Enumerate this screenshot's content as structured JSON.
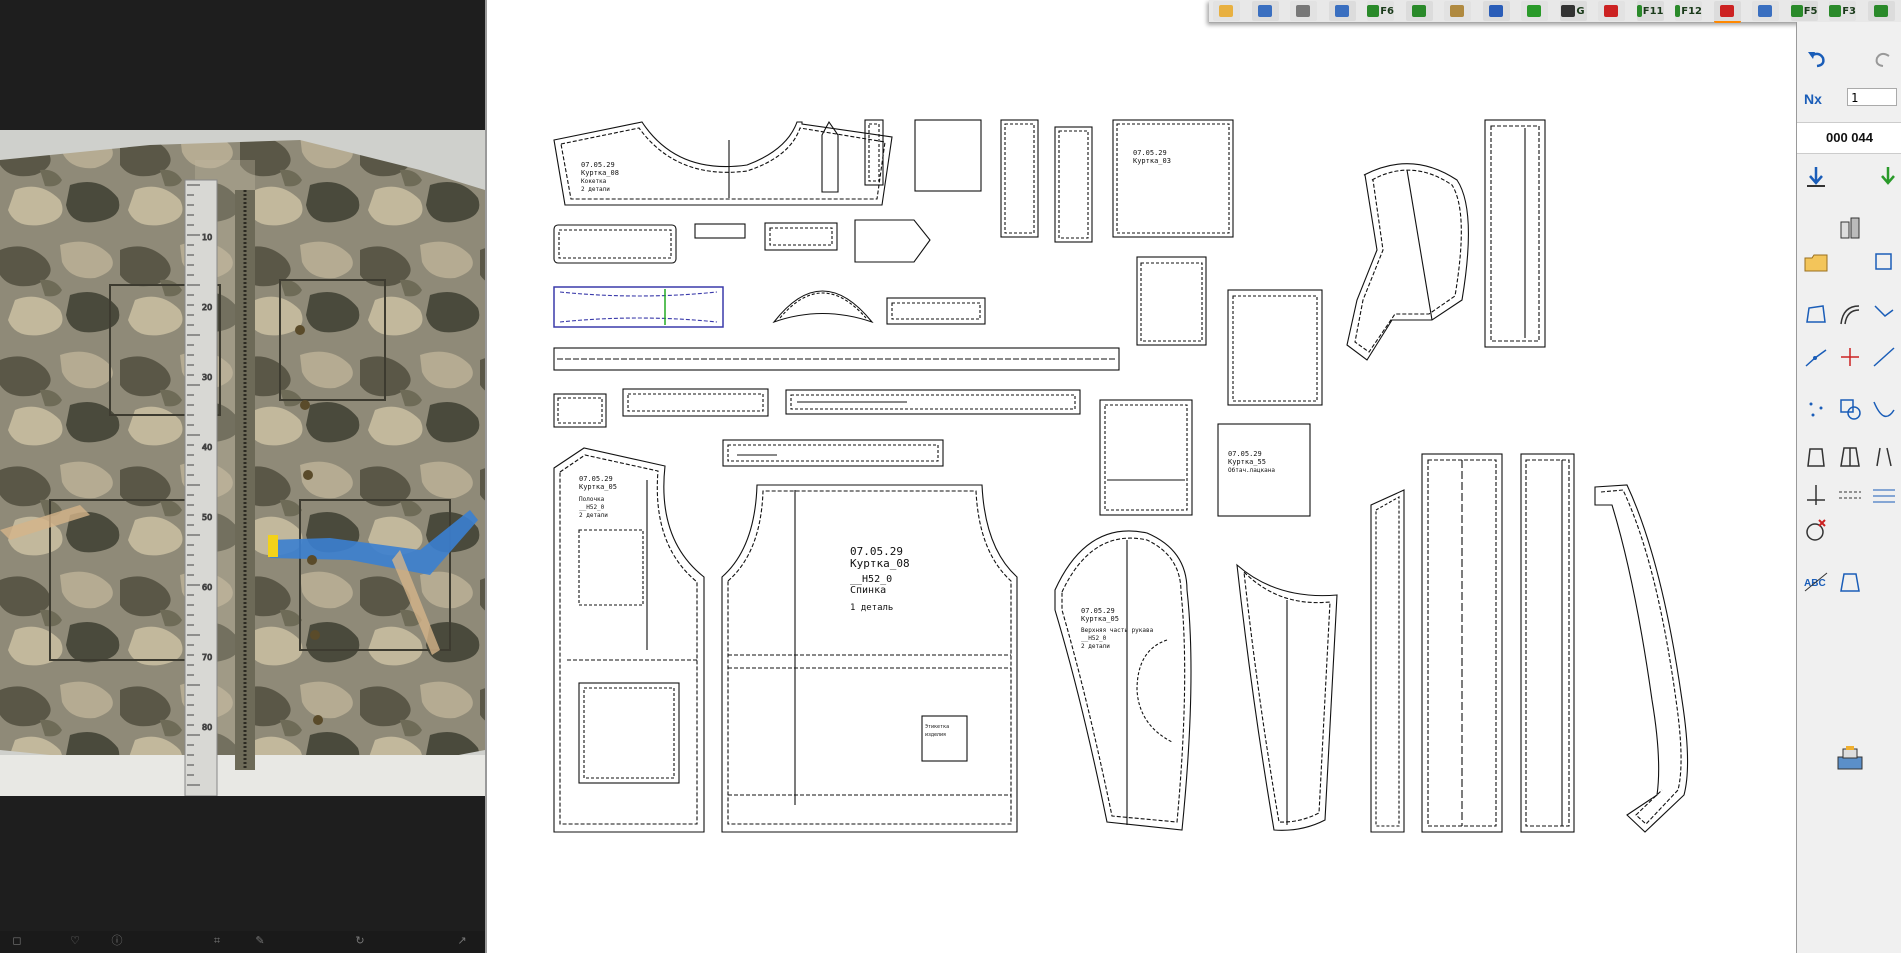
{
  "colors": {
    "accent": "#ff8800",
    "pattern_line": "#111111",
    "selected_outline": "#3a3aaa",
    "seam_green": "#22aa22"
  },
  "toolbar": {
    "buttons": [
      {
        "name": "open-folder-icon",
        "label": ""
      },
      {
        "name": "save-icon",
        "label": ""
      },
      {
        "name": "print-icon",
        "label": ""
      },
      {
        "name": "zoom-icon",
        "label": ""
      },
      {
        "name": "f6-button",
        "label": "F6"
      },
      {
        "name": "copy-icon",
        "label": ""
      },
      {
        "name": "grid-icon",
        "label": ""
      },
      {
        "name": "download-icon",
        "label": ""
      },
      {
        "name": "download-green-icon",
        "label": ""
      },
      {
        "name": "g-tool-icon",
        "label": "G"
      },
      {
        "name": "cut-icon",
        "label": ""
      },
      {
        "name": "f11-button",
        "label": "F11"
      },
      {
        "name": "f12-button",
        "label": "F12"
      },
      {
        "name": "flag-icon",
        "label": ""
      },
      {
        "name": "layers-icon",
        "label": ""
      },
      {
        "name": "f5-button",
        "label": "F5"
      },
      {
        "name": "f3-button",
        "label": "F3"
      },
      {
        "name": "more-icon",
        "label": ""
      }
    ]
  },
  "right_panel": {
    "page_value": "1",
    "counter": "000 044"
  },
  "viewer": {
    "ruler_ticks": [
      "10",
      "20",
      "30",
      "40",
      "50",
      "60",
      "70",
      "80"
    ]
  },
  "pieces": {
    "yoke": {
      "l1": "07.05.29",
      "l2": "Куртка_08",
      "l3": "Кокетка",
      "l4": "2 детали"
    },
    "collar": {
      "l1": "07.05.29",
      "l2": "Куртка_08"
    },
    "back": {
      "l1": "07.05.29",
      "l2": "Куртка_08",
      "l3": "__Н52_0",
      "l4": "Спинка",
      "l5": "1 деталь"
    },
    "front": {
      "l1": "07.05.29",
      "l2": "Куртка_05",
      "l3": "Полочка",
      "l4": "__Н52_0",
      "l5": "2 детали"
    },
    "sleeve": {
      "l1": "07.05.29",
      "l2": "Куртка_05",
      "l3": "Верхняя часть рукава",
      "l4": "__Н52_0",
      "l5": "2 детали"
    },
    "facing": {
      "l1": "07.05.29",
      "l2": "Куртка_55",
      "l3": "Обтач.лацкана"
    },
    "pocket_flap": {
      "l1": "07.05.29",
      "l2": "Куртка_05"
    },
    "big_rect": {
      "l1": "07.05.29",
      "l2": "Куртка_03"
    },
    "label": {
      "l1": "Этикетка",
      "l2": "изделия"
    }
  }
}
